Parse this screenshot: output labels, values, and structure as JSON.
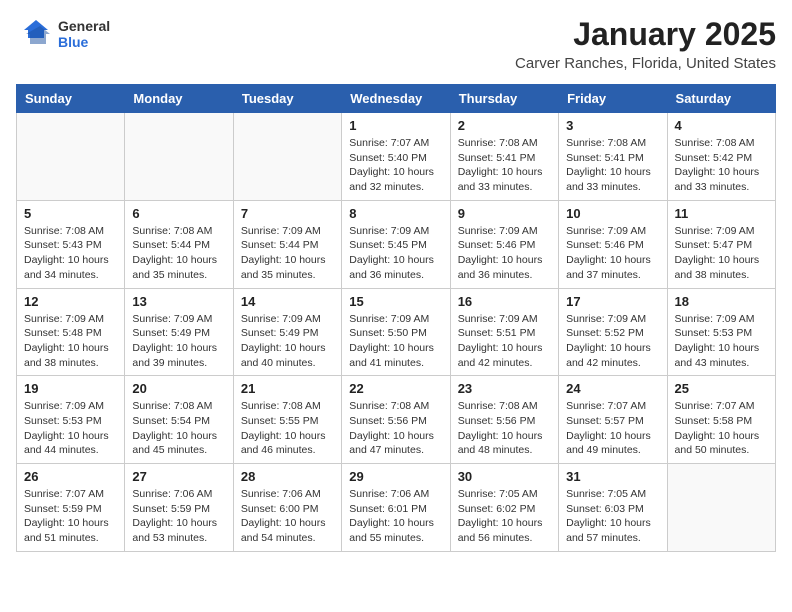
{
  "logo": {
    "general": "General",
    "blue": "Blue"
  },
  "header": {
    "title": "January 2025",
    "subtitle": "Carver Ranches, Florida, United States"
  },
  "days_of_week": [
    "Sunday",
    "Monday",
    "Tuesday",
    "Wednesday",
    "Thursday",
    "Friday",
    "Saturday"
  ],
  "weeks": [
    [
      {
        "day": "",
        "info": ""
      },
      {
        "day": "",
        "info": ""
      },
      {
        "day": "",
        "info": ""
      },
      {
        "day": "1",
        "info": "Sunrise: 7:07 AM\nSunset: 5:40 PM\nDaylight: 10 hours\nand 32 minutes."
      },
      {
        "day": "2",
        "info": "Sunrise: 7:08 AM\nSunset: 5:41 PM\nDaylight: 10 hours\nand 33 minutes."
      },
      {
        "day": "3",
        "info": "Sunrise: 7:08 AM\nSunset: 5:41 PM\nDaylight: 10 hours\nand 33 minutes."
      },
      {
        "day": "4",
        "info": "Sunrise: 7:08 AM\nSunset: 5:42 PM\nDaylight: 10 hours\nand 33 minutes."
      }
    ],
    [
      {
        "day": "5",
        "info": "Sunrise: 7:08 AM\nSunset: 5:43 PM\nDaylight: 10 hours\nand 34 minutes."
      },
      {
        "day": "6",
        "info": "Sunrise: 7:08 AM\nSunset: 5:44 PM\nDaylight: 10 hours\nand 35 minutes."
      },
      {
        "day": "7",
        "info": "Sunrise: 7:09 AM\nSunset: 5:44 PM\nDaylight: 10 hours\nand 35 minutes."
      },
      {
        "day": "8",
        "info": "Sunrise: 7:09 AM\nSunset: 5:45 PM\nDaylight: 10 hours\nand 36 minutes."
      },
      {
        "day": "9",
        "info": "Sunrise: 7:09 AM\nSunset: 5:46 PM\nDaylight: 10 hours\nand 36 minutes."
      },
      {
        "day": "10",
        "info": "Sunrise: 7:09 AM\nSunset: 5:46 PM\nDaylight: 10 hours\nand 37 minutes."
      },
      {
        "day": "11",
        "info": "Sunrise: 7:09 AM\nSunset: 5:47 PM\nDaylight: 10 hours\nand 38 minutes."
      }
    ],
    [
      {
        "day": "12",
        "info": "Sunrise: 7:09 AM\nSunset: 5:48 PM\nDaylight: 10 hours\nand 38 minutes."
      },
      {
        "day": "13",
        "info": "Sunrise: 7:09 AM\nSunset: 5:49 PM\nDaylight: 10 hours\nand 39 minutes."
      },
      {
        "day": "14",
        "info": "Sunrise: 7:09 AM\nSunset: 5:49 PM\nDaylight: 10 hours\nand 40 minutes."
      },
      {
        "day": "15",
        "info": "Sunrise: 7:09 AM\nSunset: 5:50 PM\nDaylight: 10 hours\nand 41 minutes."
      },
      {
        "day": "16",
        "info": "Sunrise: 7:09 AM\nSunset: 5:51 PM\nDaylight: 10 hours\nand 42 minutes."
      },
      {
        "day": "17",
        "info": "Sunrise: 7:09 AM\nSunset: 5:52 PM\nDaylight: 10 hours\nand 42 minutes."
      },
      {
        "day": "18",
        "info": "Sunrise: 7:09 AM\nSunset: 5:53 PM\nDaylight: 10 hours\nand 43 minutes."
      }
    ],
    [
      {
        "day": "19",
        "info": "Sunrise: 7:09 AM\nSunset: 5:53 PM\nDaylight: 10 hours\nand 44 minutes."
      },
      {
        "day": "20",
        "info": "Sunrise: 7:08 AM\nSunset: 5:54 PM\nDaylight: 10 hours\nand 45 minutes."
      },
      {
        "day": "21",
        "info": "Sunrise: 7:08 AM\nSunset: 5:55 PM\nDaylight: 10 hours\nand 46 minutes."
      },
      {
        "day": "22",
        "info": "Sunrise: 7:08 AM\nSunset: 5:56 PM\nDaylight: 10 hours\nand 47 minutes."
      },
      {
        "day": "23",
        "info": "Sunrise: 7:08 AM\nSunset: 5:56 PM\nDaylight: 10 hours\nand 48 minutes."
      },
      {
        "day": "24",
        "info": "Sunrise: 7:07 AM\nSunset: 5:57 PM\nDaylight: 10 hours\nand 49 minutes."
      },
      {
        "day": "25",
        "info": "Sunrise: 7:07 AM\nSunset: 5:58 PM\nDaylight: 10 hours\nand 50 minutes."
      }
    ],
    [
      {
        "day": "26",
        "info": "Sunrise: 7:07 AM\nSunset: 5:59 PM\nDaylight: 10 hours\nand 51 minutes."
      },
      {
        "day": "27",
        "info": "Sunrise: 7:06 AM\nSunset: 5:59 PM\nDaylight: 10 hours\nand 53 minutes."
      },
      {
        "day": "28",
        "info": "Sunrise: 7:06 AM\nSunset: 6:00 PM\nDaylight: 10 hours\nand 54 minutes."
      },
      {
        "day": "29",
        "info": "Sunrise: 7:06 AM\nSunset: 6:01 PM\nDaylight: 10 hours\nand 55 minutes."
      },
      {
        "day": "30",
        "info": "Sunrise: 7:05 AM\nSunset: 6:02 PM\nDaylight: 10 hours\nand 56 minutes."
      },
      {
        "day": "31",
        "info": "Sunrise: 7:05 AM\nSunset: 6:03 PM\nDaylight: 10 hours\nand 57 minutes."
      },
      {
        "day": "",
        "info": ""
      }
    ]
  ]
}
